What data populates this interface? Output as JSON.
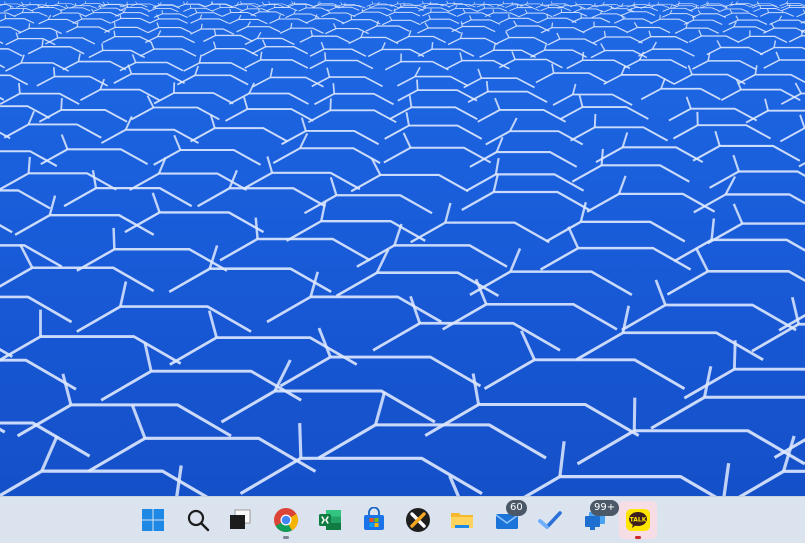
{
  "desktop": {
    "wallpaper": "salt-flat-hexagon-pattern",
    "base_color": "#1a5fdc",
    "crack_color": "#dfe9ff"
  },
  "taskbar": {
    "background": "#dbe3ef",
    "items": [
      {
        "name": "start",
        "icon": "windows-logo-icon"
      },
      {
        "name": "search",
        "icon": "search-icon"
      },
      {
        "name": "task-view",
        "icon": "task-view-icon"
      },
      {
        "name": "chrome",
        "icon": "chrome-icon",
        "running": true
      },
      {
        "name": "excel",
        "icon": "excel-icon"
      },
      {
        "name": "store",
        "icon": "microsoft-store-icon"
      },
      {
        "name": "x-app",
        "icon": "x-app-icon"
      },
      {
        "name": "file-explorer",
        "icon": "folder-icon"
      },
      {
        "name": "mail",
        "icon": "mail-icon",
        "badge": "60"
      },
      {
        "name": "todo",
        "icon": "checkmark-icon"
      },
      {
        "name": "remote-app",
        "icon": "monitor-icon",
        "badge": "99+"
      },
      {
        "name": "kakaotalk",
        "icon": "kakaotalk-icon",
        "label": "TALK",
        "active": true
      }
    ]
  }
}
